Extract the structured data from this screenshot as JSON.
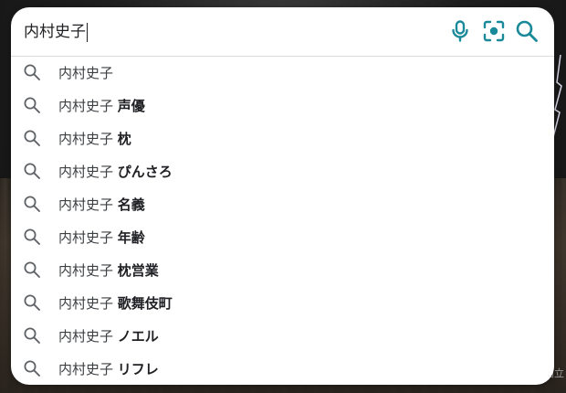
{
  "search": {
    "query": "内村史子",
    "mic_icon": "mic-icon",
    "lens_icon": "camera-lens-icon",
    "search_icon": "search-icon",
    "accent_color": "#1a8a9a"
  },
  "suggestions": [
    {
      "prefix": "内村史子",
      "suffix": ""
    },
    {
      "prefix": "内村史子",
      "suffix": "声優"
    },
    {
      "prefix": "内村史子",
      "suffix": "枕"
    },
    {
      "prefix": "内村史子",
      "suffix": "ぴんさろ"
    },
    {
      "prefix": "内村史子",
      "suffix": "名義"
    },
    {
      "prefix": "内村史子",
      "suffix": "年齢"
    },
    {
      "prefix": "内村史子",
      "suffix": "枕営業"
    },
    {
      "prefix": "内村史子",
      "suffix": "歌舞伎町"
    },
    {
      "prefix": "内村史子",
      "suffix": "ノエル"
    },
    {
      "prefix": "内村史子",
      "suffix": "リフレ"
    }
  ],
  "background": {
    "watermark": "国立"
  }
}
